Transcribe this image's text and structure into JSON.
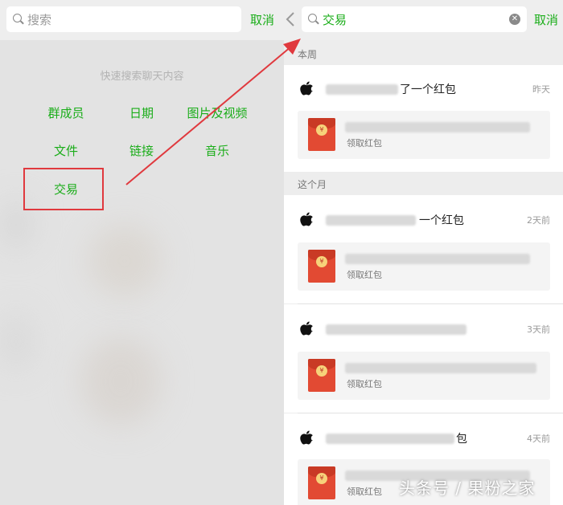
{
  "left_panel": {
    "search_placeholder": "搜索",
    "cancel_label": "取消",
    "hint": "快速搜索聊天内容",
    "quick_filters": [
      "群成员",
      "日期",
      "图片及视频",
      "文件",
      "链接",
      "音乐",
      "交易"
    ]
  },
  "right_panel": {
    "search_value": "交易",
    "cancel_label": "取消",
    "sections": [
      {
        "title": "本周",
        "entries": [
          {
            "message_fragment": "了一个红包",
            "time": "昨天",
            "card_label": "领取红包"
          }
        ]
      },
      {
        "title": "这个月",
        "entries": [
          {
            "message_fragment": "一个红包",
            "time": "2天前",
            "card_label": "领取红包"
          },
          {
            "message_fragment": "",
            "time": "3天前",
            "card_label": "领取红包"
          },
          {
            "message_fragment": "包",
            "time": "4天前",
            "card_label": "领取红包"
          }
        ]
      }
    ]
  },
  "watermark": "头条号 / 果粉之家",
  "colors": {
    "accent_green": "#1aad19",
    "annotation_red": "#e0393e",
    "red_packet": "#e24a33"
  }
}
